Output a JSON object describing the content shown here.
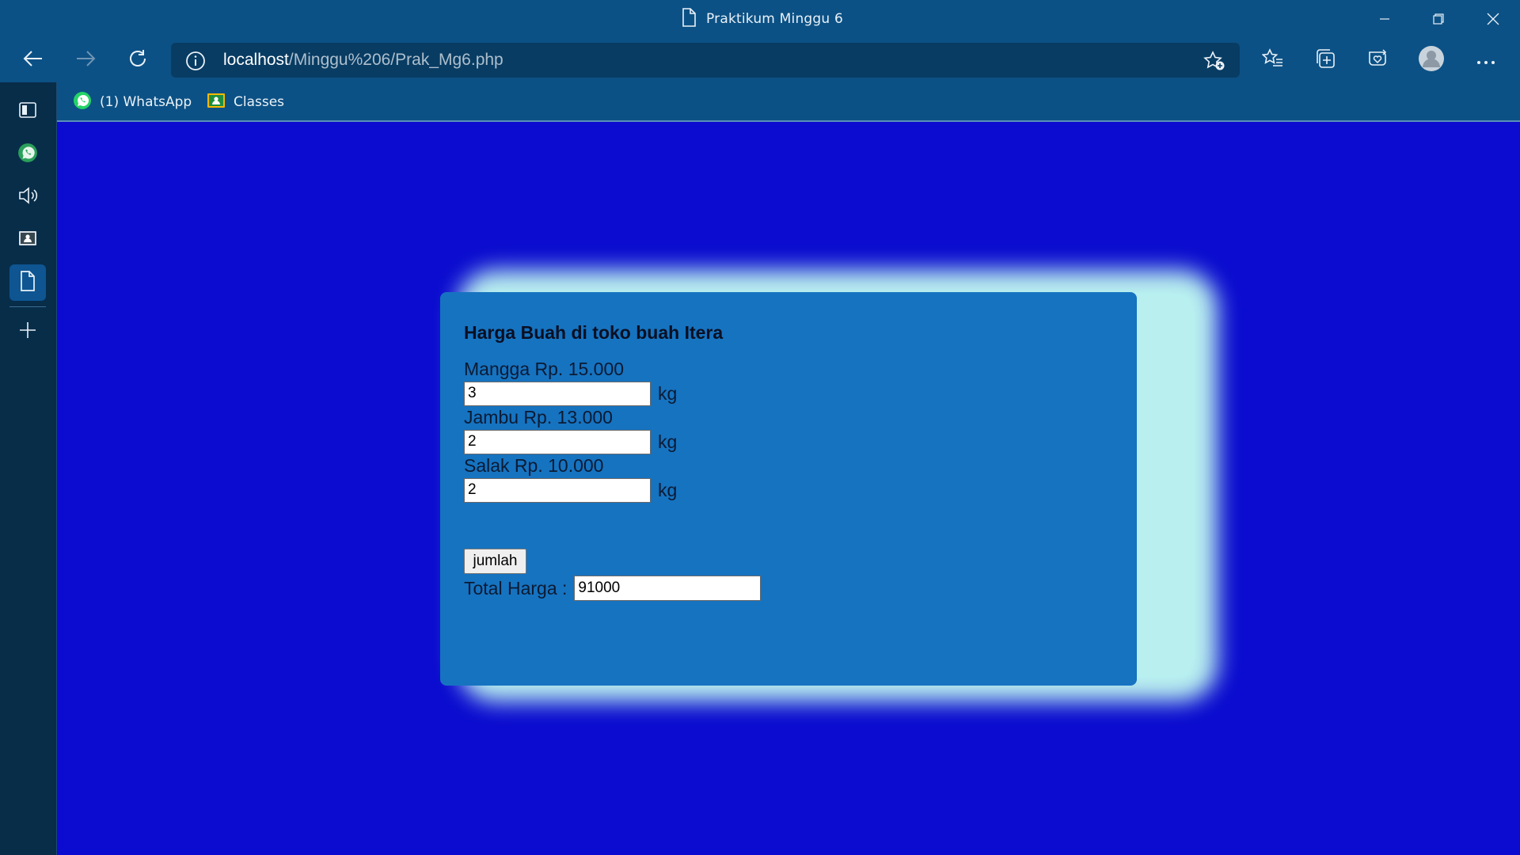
{
  "window": {
    "title": "Praktikum Minggu 6"
  },
  "address": {
    "host": "localhost",
    "path": "/Minggu%206/Prak_Mg6.php"
  },
  "bookmarks": [
    {
      "label": "(1) WhatsApp",
      "icon": "whatsapp-icon"
    },
    {
      "label": "Classes",
      "icon": "classroom-icon"
    }
  ],
  "sidebar": {
    "items": [
      "tab-actions-icon",
      "whatsapp-icon",
      "speaker-icon",
      "classroom-icon",
      "document-icon",
      "add-icon"
    ],
    "active": "document-icon"
  },
  "form": {
    "heading": "Harga Buah di toko buah Itera",
    "fruits": [
      {
        "label": "Mangga Rp. 15.000",
        "qty": "3",
        "unit": "kg"
      },
      {
        "label": "Jambu Rp. 13.000",
        "qty": "2",
        "unit": "kg"
      },
      {
        "label": "Salak Rp. 10.000",
        "qty": "2",
        "unit": "kg"
      }
    ],
    "button_label": "jumlah",
    "total_label": "Total Harga :",
    "total_value": "91000"
  },
  "colors": {
    "page_bg": "#0b0ccf",
    "card_bg": "#1673c0",
    "glow": "#b9f0ef",
    "browser_chrome": "#0c5185"
  }
}
